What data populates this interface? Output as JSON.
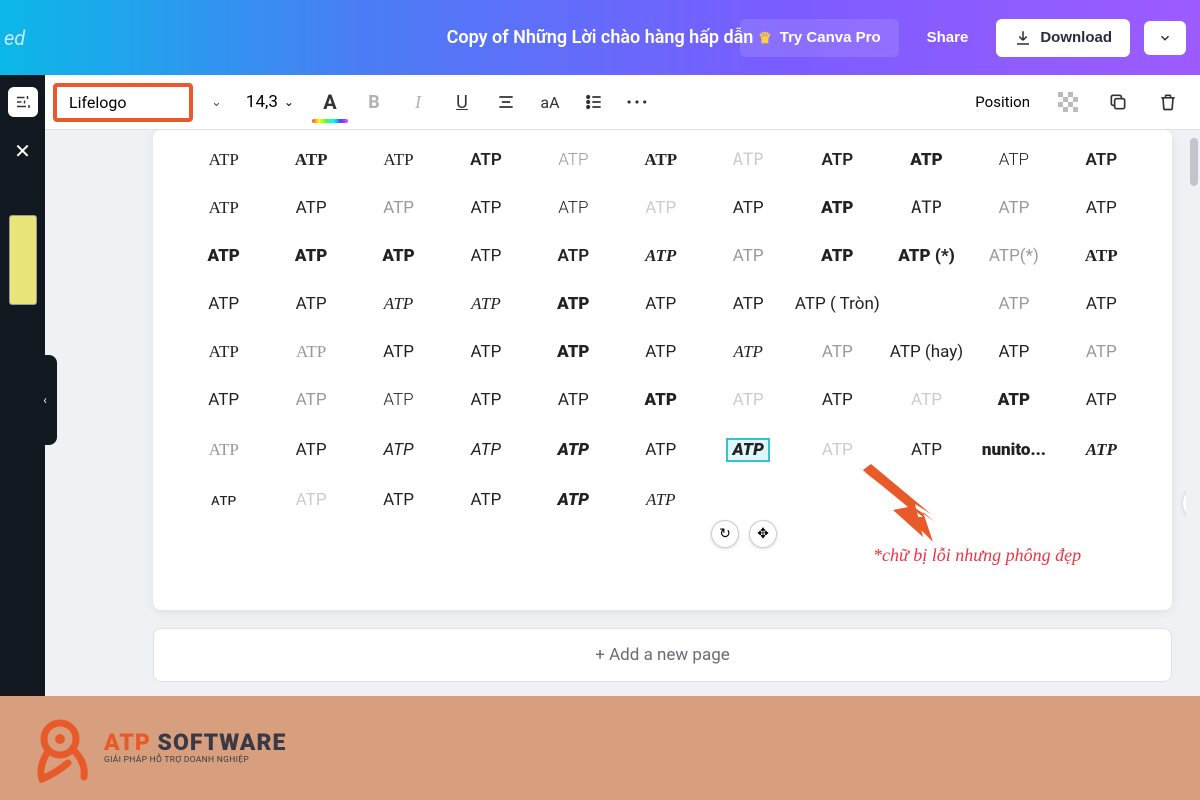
{
  "header": {
    "trailing_text": "ed",
    "doc_title": "Copy of Những Lời chào hàng hấp dẫn",
    "try_pro": "Try Canva Pro",
    "share": "Share",
    "download": "Download"
  },
  "toolbar": {
    "font_name": "Lifelogo",
    "font_size": "14,3",
    "case_label": "aA",
    "more_label": "···",
    "position": "Position"
  },
  "canvas": {
    "grid": [
      [
        {
          "t": "ATP",
          "c": "ft"
        },
        {
          "t": "ATP",
          "c": "fw4 ft"
        },
        {
          "t": "ATP",
          "c": "ft fw1"
        },
        {
          "t": "ATP",
          "c": "fw3"
        },
        {
          "t": "ATP",
          "c": "lt fw1"
        },
        {
          "t": "ATP",
          "c": "fw4 fs"
        },
        {
          "t": "ATP",
          "c": "xlt fm"
        },
        {
          "t": "ATP",
          "c": "fw3"
        },
        {
          "t": "ATP",
          "c": "fw4"
        },
        {
          "t": "ATP",
          "c": "fw1"
        },
        {
          "t": "ATP",
          "c": "fw3"
        }
      ],
      [
        {
          "t": "ATP",
          "c": "ft"
        },
        {
          "t": "ATP",
          "c": ""
        },
        {
          "t": "ATP",
          "c": "lt"
        },
        {
          "t": "ATP",
          "c": ""
        },
        {
          "t": "ATP",
          "c": "fw1"
        },
        {
          "t": "ATP",
          "c": "xlt"
        },
        {
          "t": "ATP",
          "c": ""
        },
        {
          "t": "ATP",
          "c": "fw4"
        },
        {
          "t": "ATP",
          "c": "fm"
        },
        {
          "t": "ATP",
          "c": "lt"
        },
        {
          "t": "ATP",
          "c": ""
        }
      ],
      [
        {
          "t": "ATP",
          "c": "fw4"
        },
        {
          "t": "ATP",
          "c": "fw4"
        },
        {
          "t": "ATP",
          "c": "fw4"
        },
        {
          "t": "ATP",
          "c": ""
        },
        {
          "t": "ATP",
          "c": "fw3"
        },
        {
          "t": "ATP",
          "c": "fi fs fw3"
        },
        {
          "t": "ATP",
          "c": "lt"
        },
        {
          "t": "ATP",
          "c": "fw4"
        },
        {
          "t": "ATP (*)",
          "c": "fw4"
        },
        {
          "t": "ATP(*)",
          "c": "lt"
        },
        {
          "t": "ATP",
          "c": "fw4 ft"
        }
      ],
      [
        {
          "t": "ATP",
          "c": ""
        },
        {
          "t": "ATP",
          "c": ""
        },
        {
          "t": "ATP",
          "c": "fi ft"
        },
        {
          "t": "ATP",
          "c": "fc fi"
        },
        {
          "t": "ATP",
          "c": "fw4"
        },
        {
          "t": "ATP",
          "c": ""
        },
        {
          "t": "ATP",
          "c": ""
        },
        {
          "t": "ATP ( Tròn)",
          "c": ""
        },
        {
          "t": "",
          "c": ""
        },
        {
          "t": "ATP",
          "c": "lt"
        },
        {
          "t": "ATP",
          "c": ""
        }
      ],
      [
        {
          "t": "ATP",
          "c": "ft"
        },
        {
          "t": "ATP",
          "c": "lt ft"
        },
        {
          "t": "ATP",
          "c": ""
        },
        {
          "t": "ATP",
          "c": ""
        },
        {
          "t": "ATP",
          "c": "fw4"
        },
        {
          "t": "ATP",
          "c": ""
        },
        {
          "t": "ATP",
          "c": "fi fc"
        },
        {
          "t": "ATP",
          "c": "lt"
        },
        {
          "t": "ATP (hay)",
          "c": ""
        },
        {
          "t": "ATP",
          "c": ""
        },
        {
          "t": "ATP",
          "c": "lt"
        }
      ],
      [
        {
          "t": "ATP",
          "c": ""
        },
        {
          "t": "ATP",
          "c": "lt"
        },
        {
          "t": "ATP",
          "c": "fw1"
        },
        {
          "t": "ATP",
          "c": ""
        },
        {
          "t": "ATP",
          "c": ""
        },
        {
          "t": "ATP",
          "c": "fw4"
        },
        {
          "t": "ATP",
          "c": "xlt"
        },
        {
          "t": "ATP",
          "c": ""
        },
        {
          "t": "ATP",
          "c": "xlt"
        },
        {
          "t": "ATP",
          "c": "fw4"
        },
        {
          "t": "ATP",
          "c": ""
        }
      ],
      [
        {
          "t": "ATP",
          "c": "lt ft"
        },
        {
          "t": "ATP",
          "c": ""
        },
        {
          "t": "ATP",
          "c": "fi"
        },
        {
          "t": "ATP",
          "c": "fi"
        },
        {
          "t": "ATP",
          "c": "fw4 fi"
        },
        {
          "t": "ATP",
          "c": ""
        },
        {
          "t": "ATP",
          "c": "fw4 fi",
          "sel": true
        },
        {
          "t": "ATP",
          "c": "xlt"
        },
        {
          "t": "ATP",
          "c": ""
        },
        {
          "t": "nunito...",
          "c": "fw4"
        },
        {
          "t": "ATP",
          "c": "fi fc fw3"
        }
      ],
      [
        {
          "t": "ᴀᴛᴘ",
          "c": ""
        },
        {
          "t": "ATP",
          "c": "xlt"
        },
        {
          "t": "ATP",
          "c": ""
        },
        {
          "t": "ATP",
          "c": ""
        },
        {
          "t": "ATP",
          "c": "fw4 fi"
        },
        {
          "t": "ATP",
          "c": "fi ft"
        },
        {
          "t": "",
          "c": ""
        },
        {
          "t": "",
          "c": ""
        },
        {
          "t": "",
          "c": ""
        },
        {
          "t": "",
          "c": ""
        },
        {
          "t": "",
          "c": ""
        }
      ]
    ],
    "annotation": "*chữ bị lỗi nhưng phông đẹp",
    "add_page": "+ Add a new page"
  },
  "footer": {
    "brand1": "ATP",
    "brand2": " SOFTWARE",
    "tagline": "GIẢI PHÁP HỖ TRỢ DOANH NGHIỆP"
  }
}
